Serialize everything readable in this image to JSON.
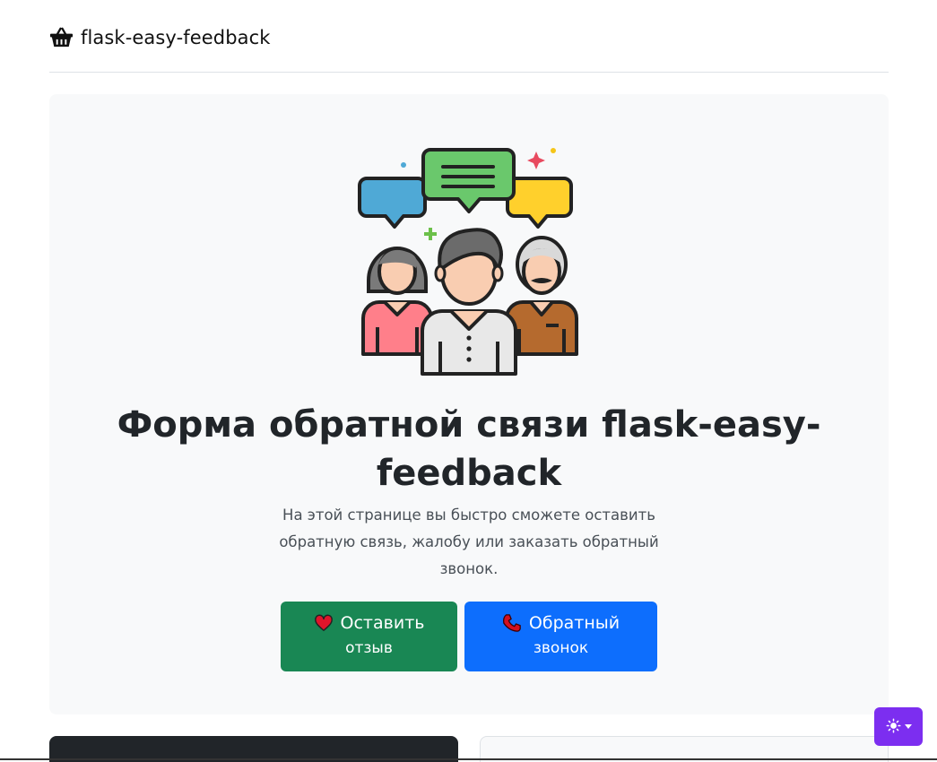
{
  "header": {
    "brand_icon": "basket-icon",
    "brand_text": "flask-easy-feedback"
  },
  "hero": {
    "illustration": "people-feedback-illustration",
    "title": "Форма обратной связи flask-easy-feedback",
    "lead": "На этой странице вы быстро сможете оставить обратную связь, жалобу или заказать обратный звонок.",
    "buttons": {
      "review": {
        "icon": "heart-icon",
        "line1": "Оставить",
        "line2": "отзыв",
        "color": "#198754"
      },
      "callback": {
        "icon": "phone-icon",
        "line1": "Обратный",
        "line2": "звонок",
        "color": "#0d6efd"
      }
    }
  },
  "theme_toggle": {
    "icon": "sun-icon",
    "color": "#7c2ef0"
  }
}
